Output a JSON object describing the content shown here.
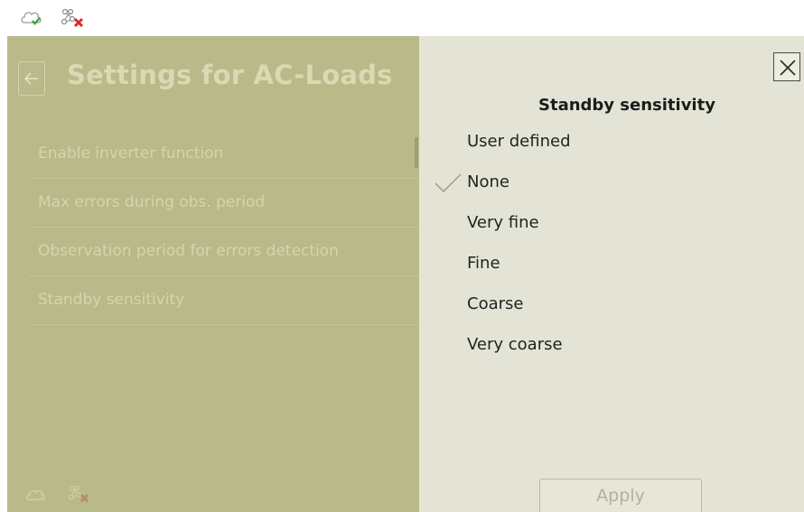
{
  "status_bar": {
    "cloud_icon": "cloud-check-icon",
    "network_icon": "network-disconnected-icon"
  },
  "settings_panel": {
    "title": "Settings for AC-Loads",
    "back_icon": "arrow-left-icon",
    "items": [
      {
        "label": "Enable inverter function"
      },
      {
        "label": "Max errors during obs. period"
      },
      {
        "label": "Observation period for errors detection"
      },
      {
        "label": "Standby sensitivity"
      }
    ]
  },
  "picker": {
    "title": "Standby sensitivity",
    "close_icon": "close-icon",
    "selected": "None",
    "options": [
      {
        "label": "User defined"
      },
      {
        "label": "None"
      },
      {
        "label": "Very fine"
      },
      {
        "label": "Fine"
      },
      {
        "label": "Coarse"
      },
      {
        "label": "Very coarse"
      }
    ],
    "apply_label": "Apply"
  },
  "colors": {
    "overlay": "#b9b98a",
    "picker_bg": "#e4e4d6",
    "check": "#9a9a8a",
    "error_red": "#e0291f",
    "ok_green": "#3aa53a"
  }
}
